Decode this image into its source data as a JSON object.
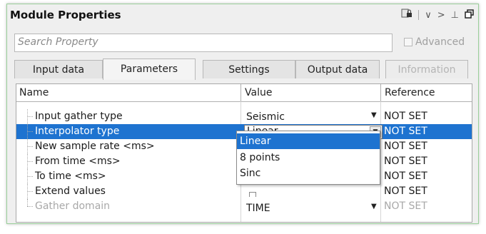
{
  "panel": {
    "title": "Module Properties",
    "toolbar_icons": [
      "lock-icon",
      "chevron-down-icon",
      "chevron-right-icon",
      "pin-icon",
      "restore-window-icon"
    ]
  },
  "search": {
    "placeholder": "Search Property"
  },
  "advanced": {
    "label": "Advanced",
    "checked": false
  },
  "tabs": [
    {
      "label": "Input data",
      "active": false,
      "disabled": false
    },
    {
      "label": "Parameters",
      "active": true,
      "disabled": false
    },
    {
      "label": "Settings",
      "active": false,
      "disabled": false
    },
    {
      "label": "Output data",
      "active": false,
      "disabled": false
    },
    {
      "label": "Information",
      "active": false,
      "disabled": true
    }
  ],
  "grid": {
    "columns": {
      "name": "Name",
      "value": "Value",
      "reference": "Reference"
    },
    "rows": [
      {
        "name": "Input gather type",
        "value": "Seismic",
        "reference": "NOT SET"
      },
      {
        "name": "Interpolator type",
        "value": "Linear",
        "reference": "NOT SET"
      },
      {
        "name": "New sample rate <ms>",
        "value": "",
        "reference": "NOT SET"
      },
      {
        "name": "From time <ms>",
        "value": "",
        "reference": "NOT SET"
      },
      {
        "name": "To time <ms>",
        "value": "",
        "reference": "NOT SET"
      },
      {
        "name": "Extend values",
        "value": "",
        "reference": "NOT SET"
      },
      {
        "name": "Gather domain",
        "value": "TIME",
        "reference": "NOT SET"
      }
    ]
  },
  "dropdown": {
    "options": [
      "Linear",
      "8 points",
      "Sinc"
    ],
    "selected": "Linear"
  },
  "colors": {
    "selection": "#1e73d0",
    "panel_border": "#9ad09a"
  }
}
